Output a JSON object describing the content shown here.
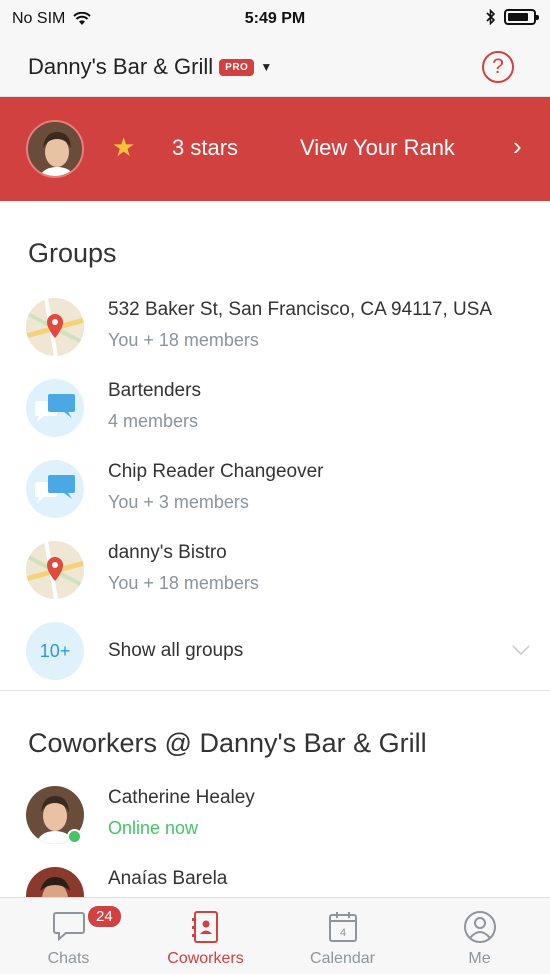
{
  "status_bar": {
    "carrier": "No SIM",
    "time": "5:49 PM"
  },
  "nav": {
    "title": "Danny's Bar & Grill",
    "badge": "PRO",
    "help_label": "?"
  },
  "rank_banner": {
    "stars": "3 stars",
    "link": "View Your Rank",
    "chevron": "›"
  },
  "groups": {
    "title": "Groups",
    "items": [
      {
        "name": "532 Baker St, San Francisco, CA 94117, USA",
        "members": "You + 18 members",
        "icon": "map-pin-icon"
      },
      {
        "name": "Bartenders",
        "members": "4 members",
        "icon": "chat-bubbles-icon"
      },
      {
        "name": "Chip Reader Changeover",
        "members": "You + 3 members",
        "icon": "chat-bubbles-icon"
      },
      {
        "name": "danny's Bistro",
        "members": "You + 18 members",
        "icon": "map-pin-icon"
      }
    ],
    "show_all": {
      "count": "10+",
      "label": "Show all groups"
    }
  },
  "coworkers": {
    "title": "Coworkers @ Danny's Bar & Grill",
    "items": [
      {
        "name": "Catherine Healey",
        "status": "Online now"
      },
      {
        "name": "Anaías Barela",
        "status": ""
      }
    ]
  },
  "tabs": [
    {
      "label": "Chats",
      "badge": "24",
      "icon": "chat-icon"
    },
    {
      "label": "Coworkers",
      "icon": "contacts-icon",
      "active": true
    },
    {
      "label": "Calendar",
      "icon": "calendar-icon",
      "day": "4"
    },
    {
      "label": "Me",
      "icon": "profile-icon"
    }
  ],
  "colors": {
    "accent": "#d0413f",
    "online": "#45c466",
    "info": "#2f9ad9"
  }
}
